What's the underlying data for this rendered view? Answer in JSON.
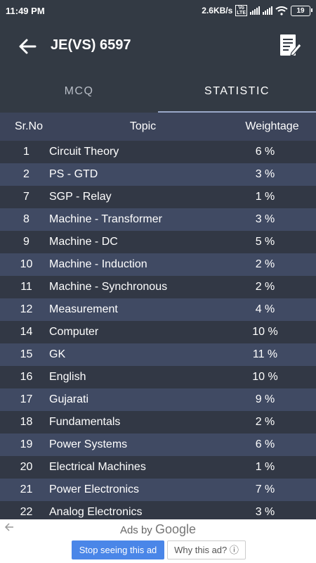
{
  "status": {
    "time": "11:49 PM",
    "speed": "2.6KB/s",
    "battery": "19",
    "net_badge_1": "Vo\nLTE",
    "net_badge_2": "4G"
  },
  "appbar": {
    "title": "JE(VS) 6597"
  },
  "tabs": [
    {
      "label": "MCQ"
    },
    {
      "label": "STATISTIC"
    }
  ],
  "table": {
    "headers": {
      "sr": "Sr.No",
      "topic": "Topic",
      "weightage": "Weightage"
    },
    "rows": [
      {
        "sr": "1",
        "topic": "Circuit Theory",
        "weightage": "6 %"
      },
      {
        "sr": "2",
        "topic": "PS - GTD",
        "weightage": "3 %"
      },
      {
        "sr": "7",
        "topic": "SGP - Relay",
        "weightage": "1 %"
      },
      {
        "sr": "8",
        "topic": "Machine - Transformer",
        "weightage": "3 %"
      },
      {
        "sr": "9",
        "topic": "Machine - DC",
        "weightage": "5 %"
      },
      {
        "sr": "10",
        "topic": "Machine - Induction",
        "weightage": "2 %"
      },
      {
        "sr": "11",
        "topic": "Machine - Synchronous",
        "weightage": "2 %"
      },
      {
        "sr": "12",
        "topic": "Measurement",
        "weightage": "4 %"
      },
      {
        "sr": "14",
        "topic": "Computer",
        "weightage": "10 %"
      },
      {
        "sr": "15",
        "topic": "GK",
        "weightage": "11 %"
      },
      {
        "sr": "16",
        "topic": "English",
        "weightage": "10 %"
      },
      {
        "sr": "17",
        "topic": "Gujarati",
        "weightage": "9 %"
      },
      {
        "sr": "18",
        "topic": "Fundamentals",
        "weightage": "2 %"
      },
      {
        "sr": "19",
        "topic": "Power Systems",
        "weightage": "6 %"
      },
      {
        "sr": "20",
        "topic": "Electrical Machines",
        "weightage": "1 %"
      },
      {
        "sr": "21",
        "topic": "Power Electronics",
        "weightage": "7 %"
      },
      {
        "sr": "22",
        "topic": "Analog Electronics",
        "weightage": "3 %"
      }
    ]
  },
  "ad": {
    "label_prefix": "Ads by ",
    "label_brand": "Google",
    "stop_button": "Stop seeing this ad",
    "why_button": "Why this ad? ⓘ"
  }
}
